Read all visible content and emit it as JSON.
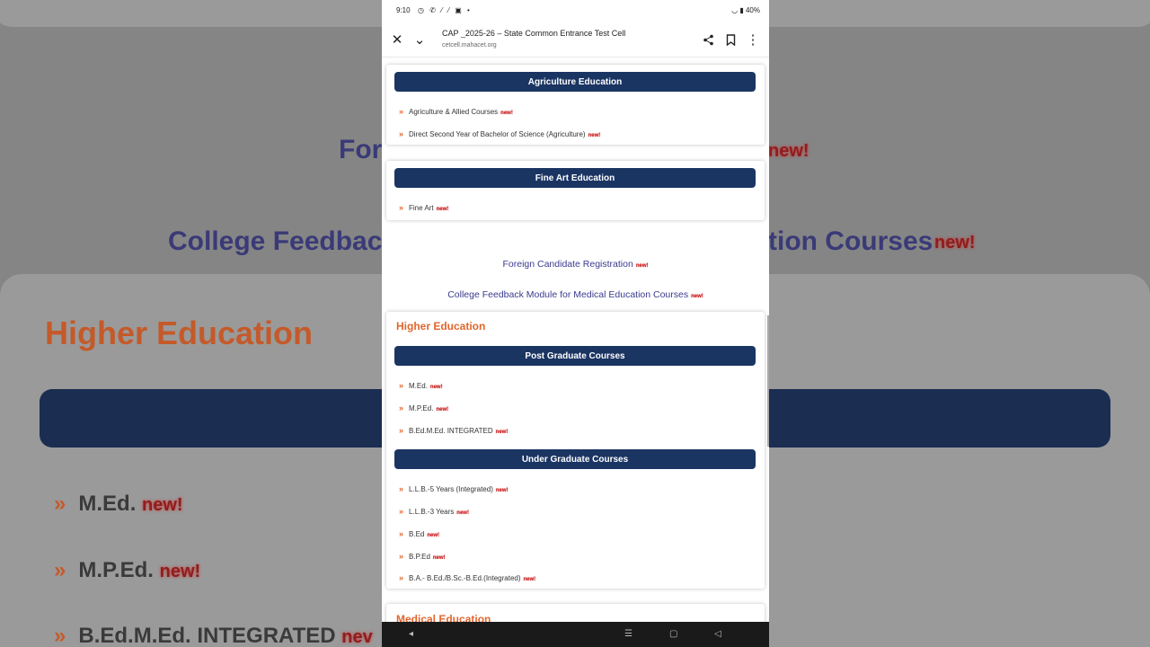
{
  "status": {
    "time": "9:10",
    "icons": "◷ ✆ ⁄ ⁄ ▣ •",
    "right": "40%"
  },
  "toolbar": {
    "title": "CAP _2025-26 – State Common Entrance Test Cell",
    "url": "cetcell.mahacet.org"
  },
  "agriculture": {
    "heading": "Agriculture Education",
    "items": [
      {
        "label": "Agriculture & Allied Courses",
        "badge": "new!"
      },
      {
        "label": "Direct Second Year of Bachelor of Science (Agriculture)",
        "badge": "new!"
      }
    ]
  },
  "fineart": {
    "heading": "Fine Art Education",
    "items": [
      {
        "label": "Fine Art",
        "badge": "new!"
      }
    ]
  },
  "links": {
    "foreign": "Foreign Candidate Registration",
    "foreign_badge": "new!",
    "feedback": "College Feedback Module for Medical Education Courses",
    "feedback_badge": "new!"
  },
  "higher": {
    "title": "Higher Education",
    "pg_heading": "Post Graduate Courses",
    "pg_items": [
      {
        "label": "M.Ed.",
        "badge": "new!"
      },
      {
        "label": "M.P.Ed.",
        "badge": "new!"
      },
      {
        "label": "B.Ed.M.Ed. INTEGRATED",
        "badge": "new!"
      }
    ],
    "ug_heading": "Under Graduate Courses",
    "ug_items": [
      {
        "label": "L.L.B.-5 Years (Integrated)",
        "badge": "new!"
      },
      {
        "label": "L.L.B.-3 Years",
        "badge": "new!"
      },
      {
        "label": "B.Ed",
        "badge": "new!"
      },
      {
        "label": "B.P.Ed",
        "badge": "new!"
      },
      {
        "label": "B.A.- B.Ed./B.Sc.-B.Ed.(Integrated)",
        "badge": "new!"
      }
    ]
  },
  "medical": {
    "title": "Medical Education"
  },
  "background": {
    "fore": "Fore",
    "new1": "new!",
    "college": "College Feedbac",
    "tion": "tion Courses",
    "new2": "new!",
    "higher": "Higher Education",
    "med": "M.Ed.",
    "med_new": "new!",
    "mped": "M.P.Ed.",
    "mped_new": "new!",
    "bedmed": "B.Ed.M.Ed. INTEGRATED",
    "bedmed_new": "nev"
  },
  "colors": {
    "accent": "#e0662d",
    "header_bar": "#1b3563",
    "link": "#3b3b8f",
    "badge": "#c41e1e"
  }
}
